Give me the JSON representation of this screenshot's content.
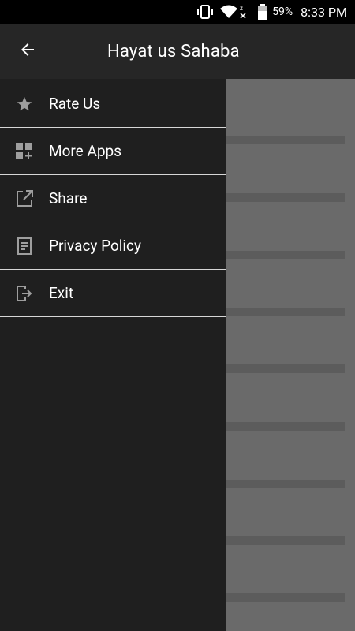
{
  "status_bar": {
    "battery_percent": "59%",
    "time": "8:33 PM",
    "icons": [
      "vibrate-icon",
      "wifi-icon",
      "no-signal-icon",
      "battery-icon"
    ]
  },
  "app_bar": {
    "title": "Hayat us Sahaba",
    "back_icon": "arrow-back-icon"
  },
  "drawer": {
    "items": [
      {
        "label": "Rate Us",
        "icon": "star-icon"
      },
      {
        "label": "More Apps",
        "icon": "apps-grid-icon"
      },
      {
        "label": "Share",
        "icon": "share-external-icon"
      },
      {
        "label": "Privacy Policy",
        "icon": "document-icon"
      },
      {
        "label": "Exit",
        "icon": "exit-icon"
      }
    ]
  },
  "colors": {
    "app_bar": "#262626",
    "drawer": "#1f1f1f",
    "scrim_content": "#6a6a6a",
    "divider": "#d6d6d6",
    "icon": "#9e9e9e"
  }
}
